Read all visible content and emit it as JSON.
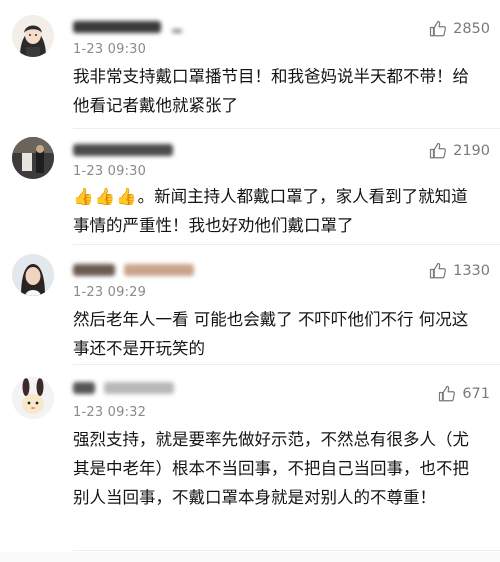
{
  "comments": [
    {
      "time": "1-23 09:30",
      "likes": "2850",
      "text": "我非常支持戴口罩播节目！和我爸妈说半天都不带！给他看记者戴他就紧张了",
      "avatar": "anime-girl-avatar"
    },
    {
      "time": "1-23 09:30",
      "likes": "2190",
      "prefix": "👍👍👍",
      "text": "。新闻主持人都戴口罩了，家人看到了就知道事情的严重性！我也好劝他们戴口罩了",
      "avatar": "room-photo-avatar"
    },
    {
      "time": "1-23 09:29",
      "likes": "1330",
      "text": "然后老年人一看 可能也会戴了 不吓吓他们不行 何况这事还不是开玩笑的",
      "avatar": "woman-photo-avatar"
    },
    {
      "time": "1-23 09:32",
      "likes": "671",
      "text": "强烈支持，就是要率先做好示范，不然总有很多人（尤其是中老年）根本不当回事，不把自己当回事，也不把别人当回事，不戴口罩本身就是对别人的不尊重！",
      "avatar": "bunny-avatar"
    }
  ],
  "icons": {
    "like": "thumbs-up-icon"
  },
  "colors": {
    "meta": "#8a8a8a",
    "text": "#141414",
    "divider": "#ececec"
  }
}
